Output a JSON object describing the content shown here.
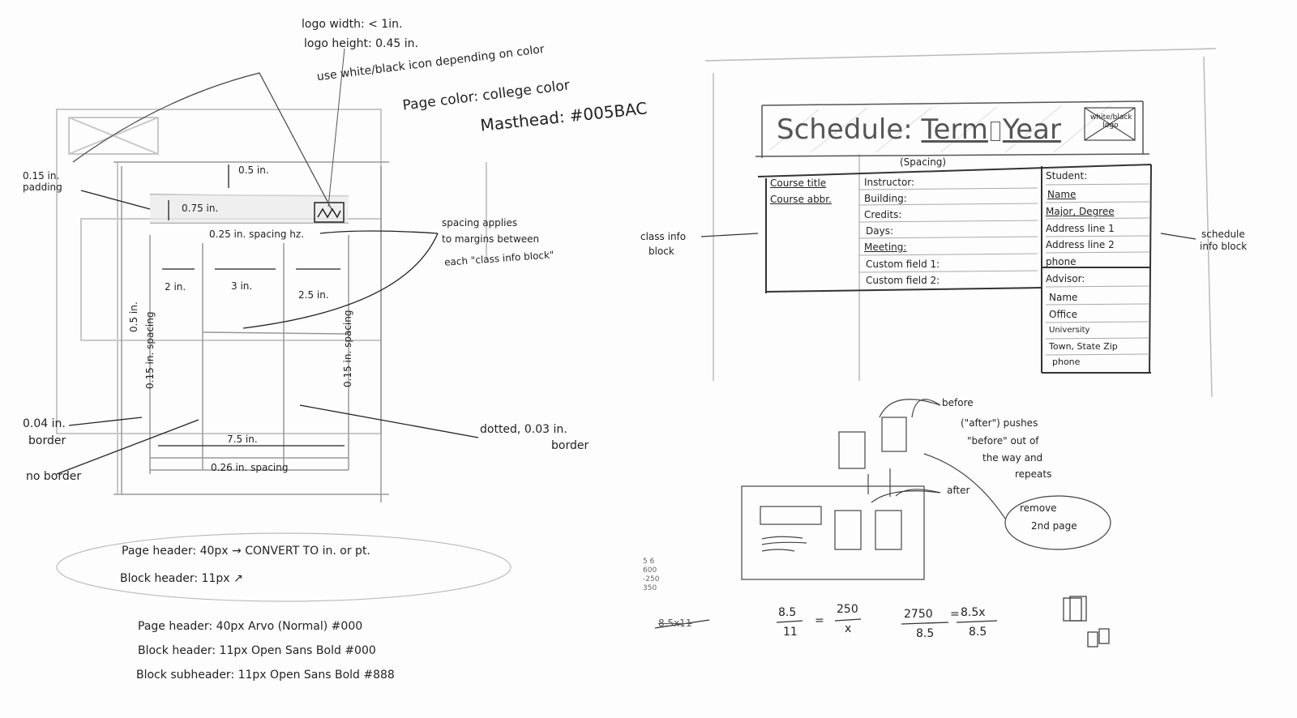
{
  "left_sketch": {
    "logo_notes": {
      "width": "logo width: < 1in.",
      "height": "logo height: 0.45 in.",
      "icon": "use white/black icon depending on color"
    },
    "page_color_notes": {
      "page_color": "Page color: college color",
      "masthead": "Masthead: #005BAC"
    },
    "dimensions": {
      "top_margin": "0.5 in.",
      "padding": "0.15 in. padding",
      "header_height": "0.75 in.",
      "spacing_hz": "0.25 in. spacing hz.",
      "col1": "2 in.",
      "col2": "3 in.",
      "col3": "2.5 in.",
      "vert_spacing": "0.5 in.",
      "left_spacing": "0.15 in. spacing",
      "right_spacing": "0.15 in. spacing",
      "total_width": "7.5 in.",
      "bottom_spacing": "0.26 in. spacing"
    },
    "callouts": {
      "spacing_applies": [
        "spacing applies",
        "to margins between",
        "each \"class info block\""
      ],
      "border": [
        "0.04 in.",
        "border"
      ],
      "no_border": "no border",
      "dotted": [
        "dotted, 0.03 in.",
        "border"
      ]
    },
    "font_notes_oval": {
      "line1": "Page header: 40px → CONVERT TO in. or pt.",
      "line2": "Block header: 11px ↗"
    },
    "font_specs": [
      "Page header: 40px Arvo (Normal) #000",
      "Block header: 11px Open Sans Bold #000",
      "Block subheader: 11px Open Sans Bold #888"
    ]
  },
  "right_sketch": {
    "header": {
      "title_prefix": "Schedule:",
      "title_term": "Term",
      "title_year": "Year",
      "logo": "white/black logo"
    },
    "spacing_label": "(Spacing)",
    "class_block": {
      "left": [
        "Course title",
        "Course abbr."
      ],
      "fields": [
        "Instructor:",
        "Building:",
        "Credits:",
        "Days:",
        "Meeting:",
        "Custom field 1:",
        "Custom field 2:"
      ]
    },
    "schedule_block": {
      "student_header": "Student:",
      "student_rows": [
        "Name",
        "Major, Degree",
        "Address line 1",
        "Address line 2",
        "phone"
      ],
      "advisor_header": "Advisor:",
      "advisor_rows": [
        "Name",
        "Office",
        "University",
        "Town, State Zip",
        "phone"
      ]
    },
    "callouts": {
      "class_info": [
        "class info",
        "block"
      ],
      "schedule_info": [
        "schedule",
        "info block"
      ],
      "before": "before",
      "after": "after",
      "pushes": [
        "(\"after\") pushes",
        "\"before\" out of",
        "the way and",
        "repeats"
      ],
      "remove": [
        "remove",
        "2nd page"
      ]
    },
    "math": {
      "scratch": [
        "5 6",
        "600",
        "-250",
        "350"
      ],
      "crossed": "8.5x11",
      "eq1_left_num": "8.5",
      "eq1_left_den": "11",
      "eq1_right_num": "250",
      "eq1_right_den": "x",
      "eq2_left_num": "2750",
      "eq2_left_den": "8.5",
      "eq2_right_num": "8.5x",
      "eq2_right_den": "8.5"
    }
  }
}
